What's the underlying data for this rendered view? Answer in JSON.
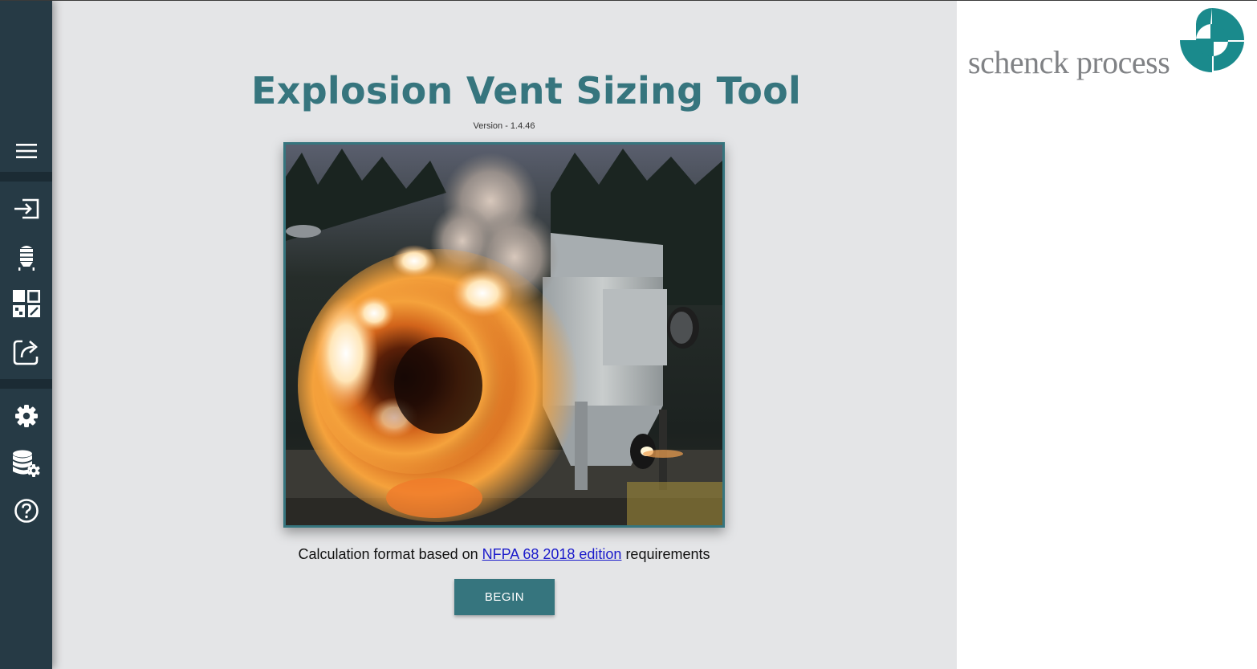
{
  "sidebar": {
    "items": [
      {
        "name": "menu",
        "icon": "menu-icon"
      },
      {
        "name": "input",
        "icon": "input-icon"
      },
      {
        "name": "vessel",
        "icon": "silo-icon"
      },
      {
        "name": "layout",
        "icon": "dashboard-icon"
      },
      {
        "name": "export",
        "icon": "share-icon"
      },
      {
        "name": "settings",
        "icon": "gear-icon"
      },
      {
        "name": "database",
        "icon": "database-settings-icon"
      },
      {
        "name": "help",
        "icon": "help-icon"
      }
    ]
  },
  "main": {
    "title": "Explosion Vent Sizing Tool",
    "version": "Version - 1.4.46",
    "caption_prefix": "Calculation format based on ",
    "caption_link": "NFPA 68 2018 edition",
    "caption_suffix": " requirements",
    "begin_label": "BEGIN"
  },
  "logo": {
    "text": "schenck process"
  },
  "colors": {
    "accent": "#36757e",
    "sidebar": "#263a45",
    "background": "#e4e5e7",
    "link": "#1a1acb"
  }
}
